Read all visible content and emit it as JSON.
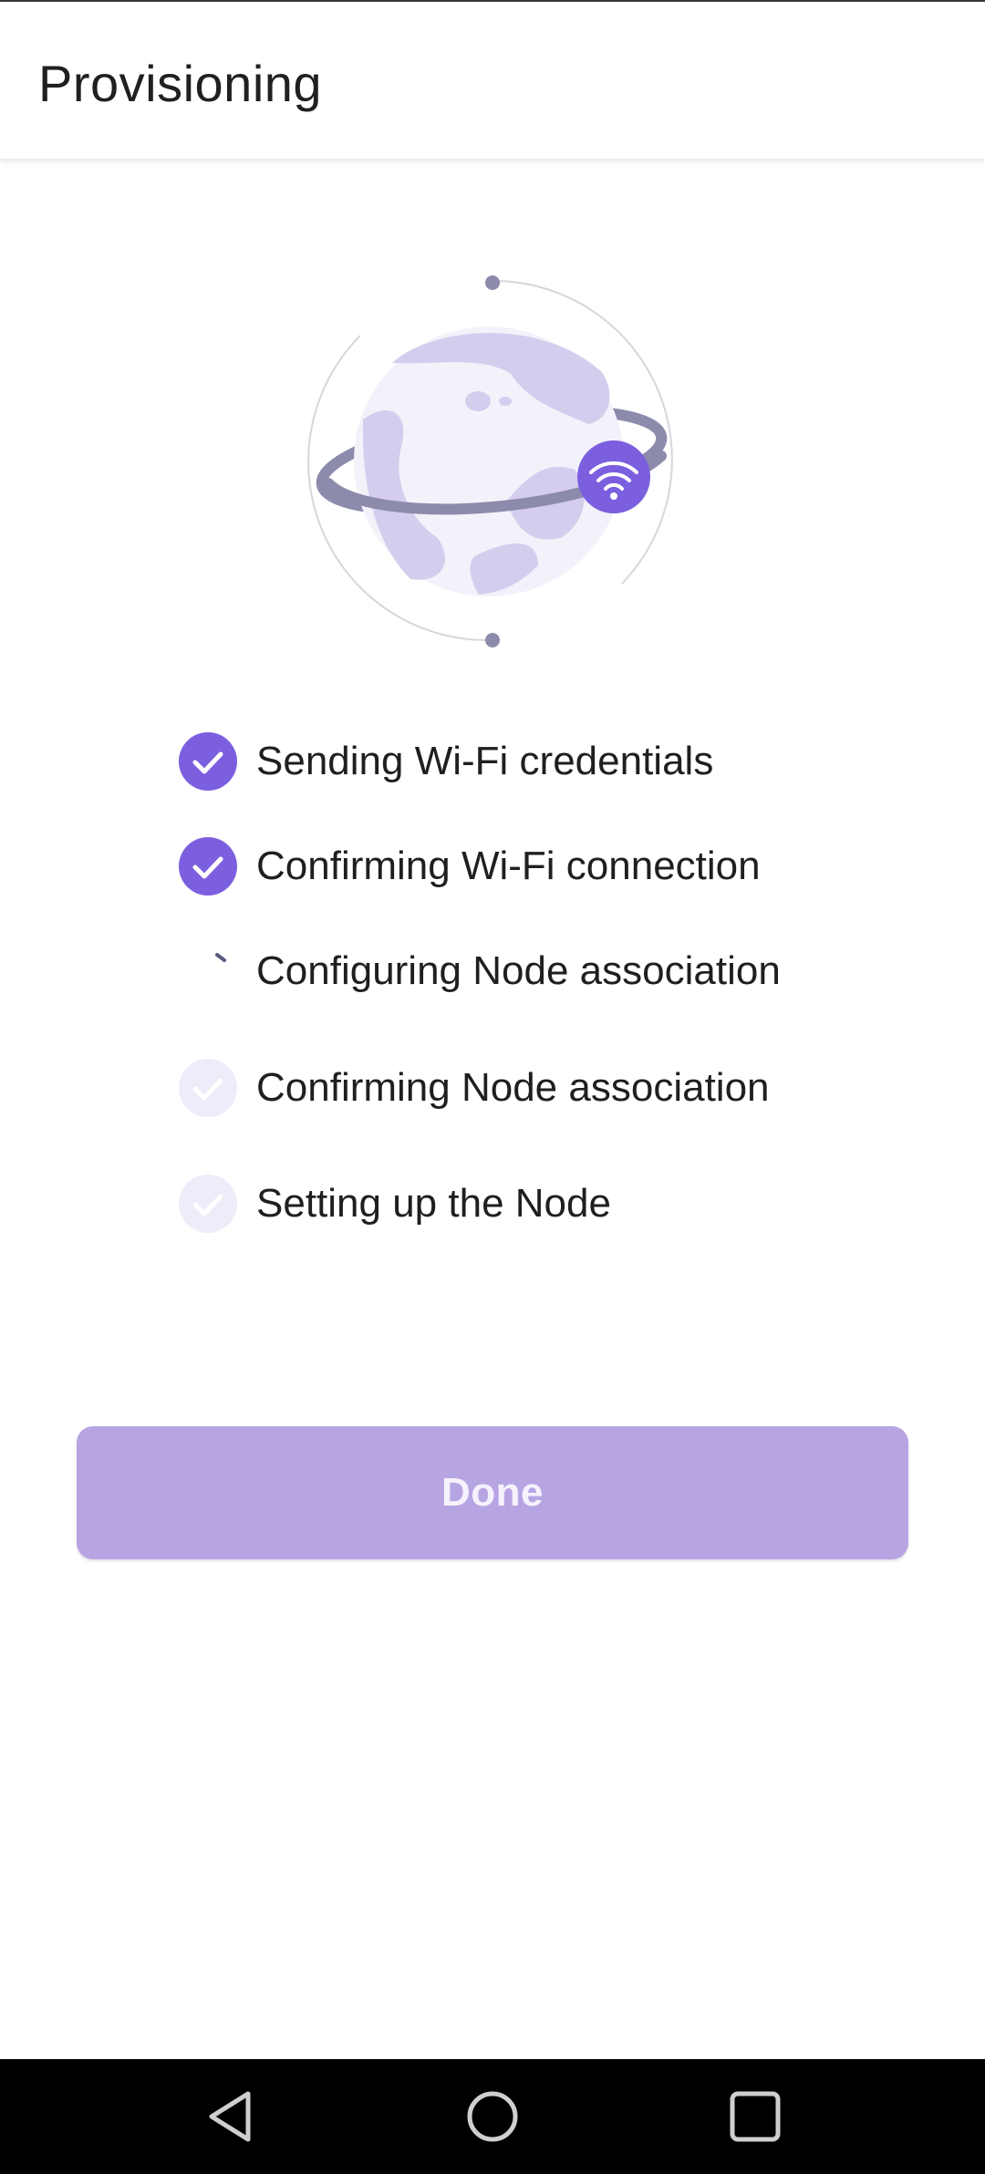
{
  "app_bar": {
    "title": "Provisioning"
  },
  "illustration": {
    "icon": "globe-wifi-icon",
    "colors": {
      "globe": "#d5cdee",
      "ring": "#8c8bab",
      "wifi_badge": "#7b5fdf"
    }
  },
  "steps": [
    {
      "label": "Sending Wi-Fi credentials",
      "status": "done"
    },
    {
      "label": "Confirming Wi-Fi connection",
      "status": "done"
    },
    {
      "label": "Configuring Node association",
      "status": "in-progress"
    },
    {
      "label": "Confirming Node association",
      "status": "pending"
    },
    {
      "label": "Setting up the Node",
      "status": "pending"
    }
  ],
  "done_button": {
    "label": "Done",
    "enabled": false
  },
  "nav": {
    "back": "back-icon",
    "home": "home-icon",
    "recents": "recents-icon"
  },
  "colors": {
    "accent": "#7b5fdf",
    "button_disabled": "#b7a5e3"
  }
}
